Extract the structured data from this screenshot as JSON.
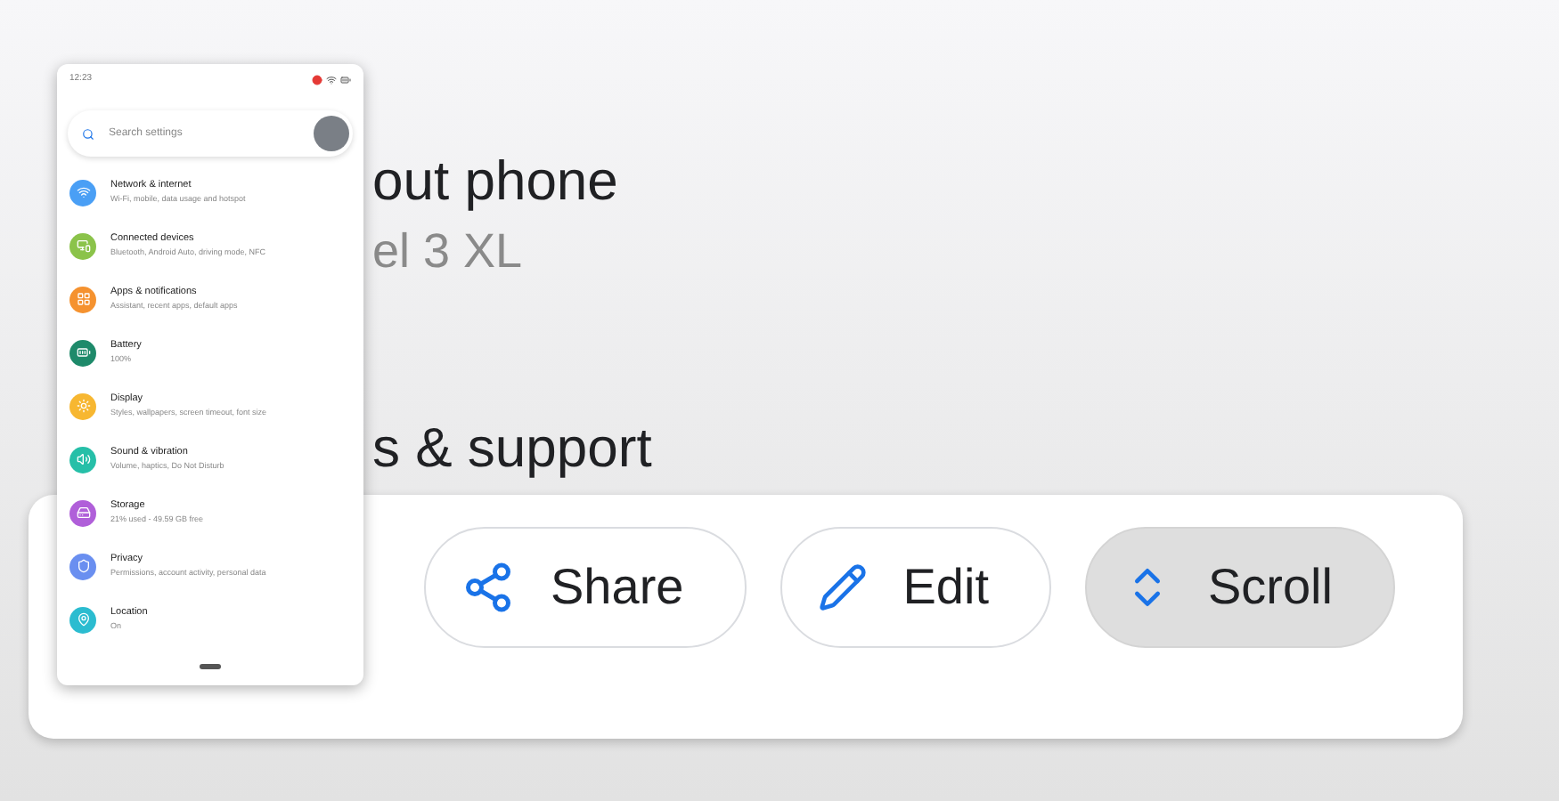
{
  "background": {
    "title": "out phone",
    "subtitle": "el 3 XL",
    "section": "s & support"
  },
  "preview": {
    "status_time": "12:23",
    "search": {
      "placeholder": "Search settings"
    },
    "items": [
      {
        "title": "Network & internet",
        "subtitle": "Wi-Fi, mobile, data usage and hotspot",
        "color": "#4a9ff5"
      },
      {
        "title": "Connected devices",
        "subtitle": "Bluetooth, Android Auto, driving mode, NFC",
        "color": "#8bc34a"
      },
      {
        "title": "Apps & notifications",
        "subtitle": "Assistant, recent apps, default apps",
        "color": "#f5922f"
      },
      {
        "title": "Battery",
        "subtitle": "100%",
        "color": "#1e8a6a"
      },
      {
        "title": "Display",
        "subtitle": "Styles, wallpapers, screen timeout, font size",
        "color": "#f7b731"
      },
      {
        "title": "Sound & vibration",
        "subtitle": "Volume, haptics, Do Not Disturb",
        "color": "#26bfa8"
      },
      {
        "title": "Storage",
        "subtitle": "21% used - 49.59 GB free",
        "color": "#b05fd9"
      },
      {
        "title": "Privacy",
        "subtitle": "Permissions, account activity, personal data",
        "color": "#6a8ff0"
      },
      {
        "title": "Location",
        "subtitle": "On",
        "color": "#2bbcd0"
      }
    ]
  },
  "actions": [
    {
      "kind": "share",
      "label": "Share",
      "selected": false
    },
    {
      "kind": "edit",
      "label": "Edit",
      "selected": false
    },
    {
      "kind": "scroll",
      "label": "Scroll",
      "selected": true
    }
  ]
}
